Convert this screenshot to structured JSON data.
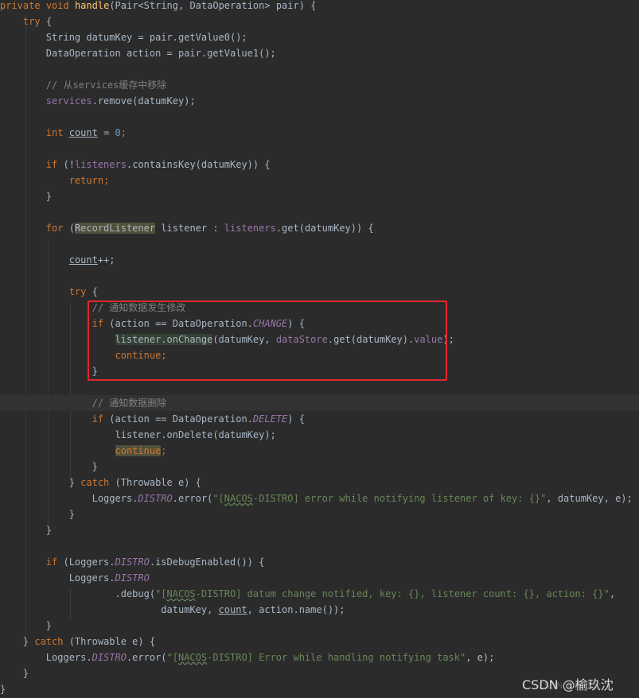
{
  "code": {
    "l1_private": "private",
    "l1_void": "void",
    "l1_handle": "handle",
    "l1_params": "(Pair<String, DataOperation> pair) {",
    "l2_try": "try",
    "l2_brace": " {",
    "l3_a": "String datumKey = pair.getValue0();",
    "l4_a": "DataOperation action = pair.getValue1();",
    "l6_comment": "// 从services缓存中移除",
    "l7_services": "services",
    "l7_rest": ".remove(datumKey);",
    "l9_int": "int",
    "l9_count": "count",
    "l9_eq": " = ",
    "l9_zero": "0",
    "l9_semi": ";",
    "l11_if": "if",
    "l11_open": " (!",
    "l11_listeners": "listeners",
    "l11_rest": ".containsKey(datumKey)) {",
    "l12_return": "return",
    "l12_semi": ";",
    "l13_brace": "}",
    "l15_for": "for",
    "l15_paren": " (",
    "l15_type": "RecordListener",
    "l15_mid": " listener : ",
    "l15_listeners": "listeners",
    "l15_rest": ".get(datumKey)) {",
    "l17_count": "count",
    "l17_rest": "++;",
    "l19_try": "try",
    "l19_brace": " {",
    "l20_comment": "// 通知数据发生修改",
    "l21_if": "if",
    "l21_mid": " (action == DataOperation.",
    "l21_const": "CHANGE",
    "l21_end": ") {",
    "l22_listener": "listener.onChange",
    "l22_mid": "(datumKey, ",
    "l22_datastore": "dataStore",
    "l22_get": ".get(datumKey).",
    "l22_value": "value",
    "l22_end": ");",
    "l23_continue": "continue",
    "l23_semi": ";",
    "l24_brace": "}",
    "l26_comment": "// 通知数据删除",
    "l27_if": "if",
    "l27_mid": " (action == DataOperation.",
    "l27_const": "DELETE",
    "l27_end": ") {",
    "l28_a": "listener.onDelete(datumKey);",
    "l29_continue": "continue",
    "l29_semi": ";",
    "l30_brace": "}",
    "l31_close": "} ",
    "l31_catch": "catch",
    "l31_rest": " (Throwable e) {",
    "l32_loggers": "Loggers.",
    "l32_distro": "DISTRO",
    "l32_error": ".error(",
    "l32_q": "\"[",
    "l32_nacos": "NACOS",
    "l32_str": "-DISTRO] error while notifying listener of key: {}\"",
    "l32_end": ", datumKey, e);",
    "l33_brace": "}",
    "l34_brace": "}",
    "l36_if": "if",
    "l36_a": " (Loggers.",
    "l36_distro": "DISTRO",
    "l36_rest": ".isDebugEnabled()) {",
    "l37_loggers": "Loggers.",
    "l37_distro": "DISTRO",
    "l38_debug": ".debug(",
    "l38_q": "\"[",
    "l38_nacos": "NACOS",
    "l38_str": "-DISTRO] datum change notified, key: {}, listener count: {}, action: {}\"",
    "l38_comma": ",",
    "l39_a": "datumKey, ",
    "l39_count": "count",
    "l39_rest": ", action.name());",
    "l40_brace": "}",
    "l41_close": "} ",
    "l41_catch": "catch",
    "l41_rest": " (Throwable e) {",
    "l42_loggers": "Loggers.",
    "l42_distro": "DISTRO",
    "l42_error": ".error(",
    "l42_q": "\"[",
    "l42_nacos": "NACOS",
    "l42_str": "-DISTRO] Error while handling notifying task\"",
    "l42_end": ", e);",
    "l43_brace": "}",
    "l44_brace": "}"
  },
  "watermark": "CSDN @榆玖沈",
  "watermark_shadow": "CSDN @榆玖沈",
  "colors": {
    "background": "#2b2b2b",
    "keyword": "#cc7832",
    "method": "#ffc66d",
    "field": "#9876aa",
    "string": "#6a8759",
    "comment": "#808080",
    "number": "#6897bb",
    "highlight_box": "#e0282e"
  }
}
